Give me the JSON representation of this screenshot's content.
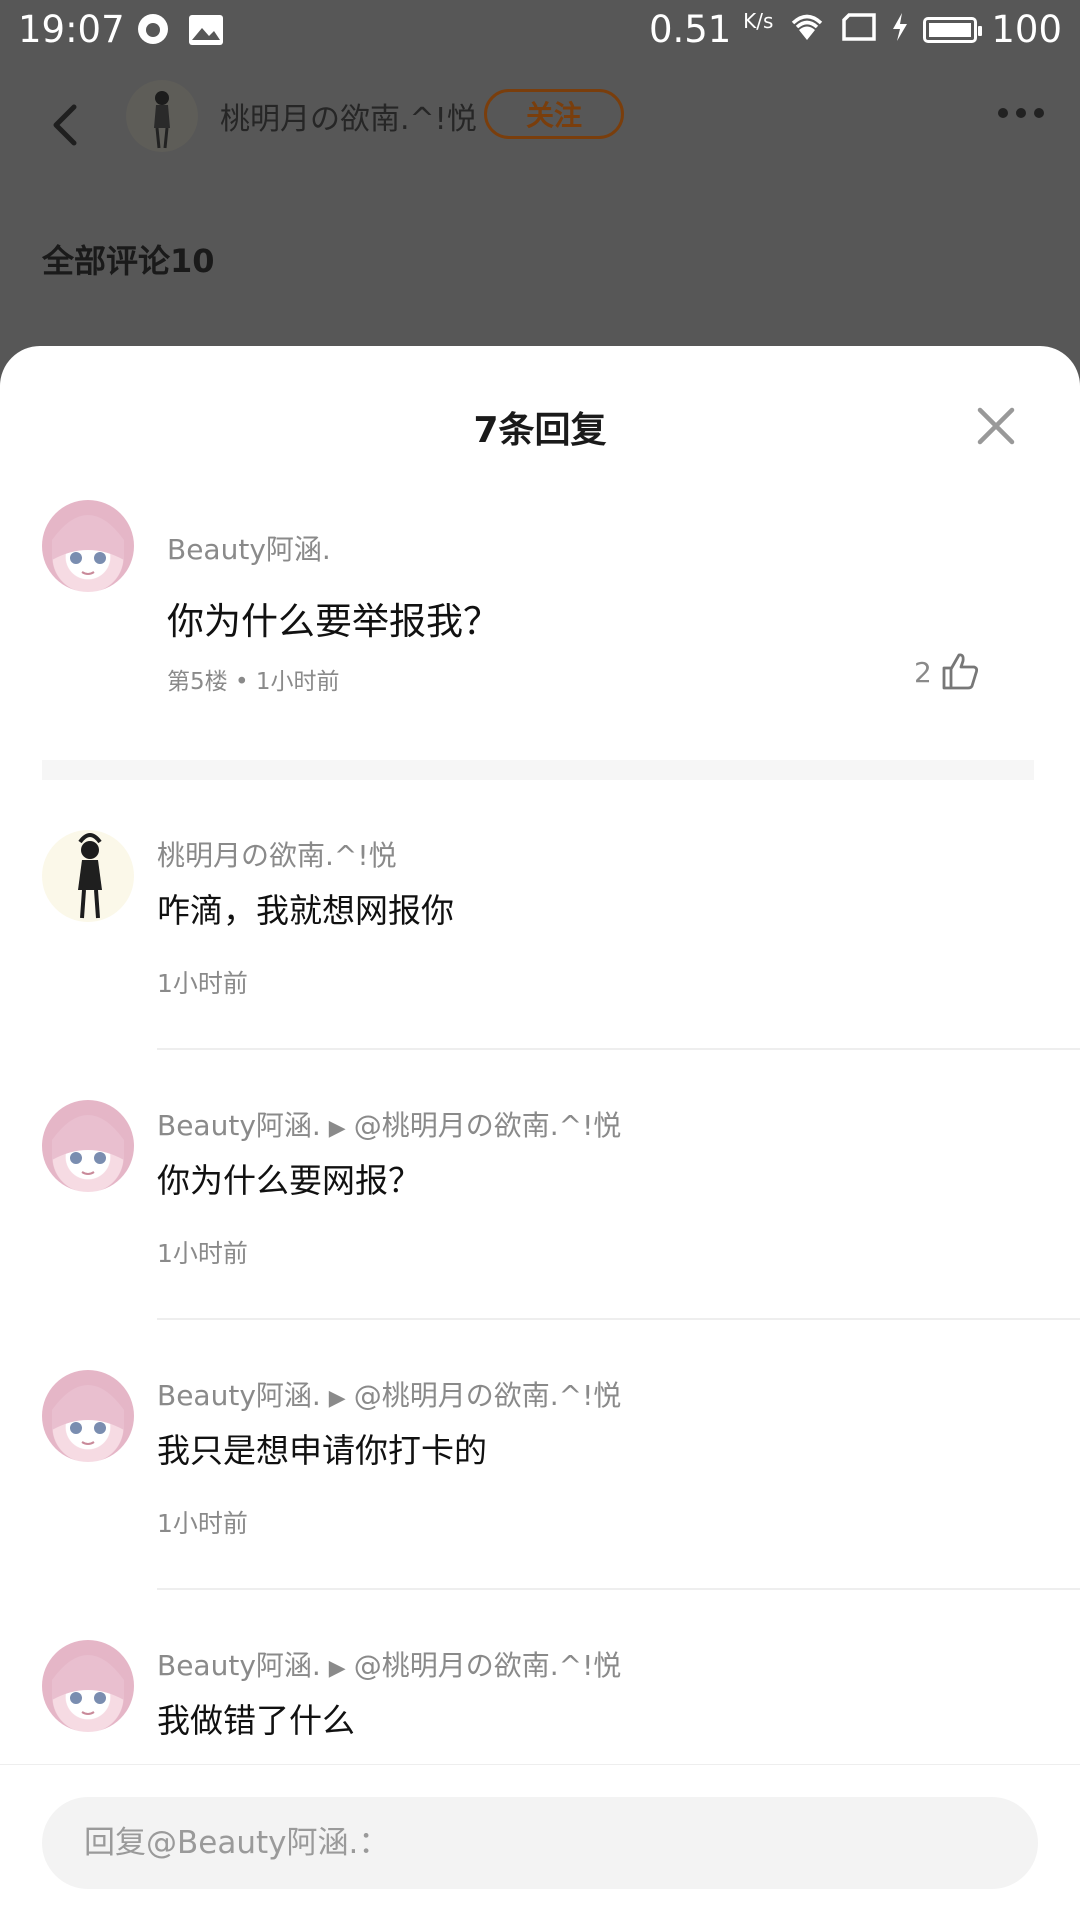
{
  "status_bar": {
    "time": "19:07",
    "speed": "0.51",
    "speed_unit": "K/s",
    "battery": "100"
  },
  "header": {
    "author_name": "桃明月の欲南.^!悦",
    "follow_label": "关注",
    "all_comments": "全部评论10"
  },
  "sheet": {
    "title": "7条回复",
    "main_comment": {
      "user": "Beauty阿涵.",
      "text": "你为什么要举报我？",
      "meta": "第5楼 • 1小时前",
      "likes": "2"
    },
    "replies": [
      {
        "user": "桃明月の欲南.^!悦",
        "target": "",
        "text": "咋滴，我就想网报你",
        "time": "1小时前",
        "avatar": "dark"
      },
      {
        "user": "Beauty阿涵.",
        "target": "@桃明月の欲南.^!悦",
        "text": "你为什么要网报？",
        "time": "1小时前",
        "avatar": "girl"
      },
      {
        "user": "Beauty阿涵.",
        "target": "@桃明月の欲南.^!悦",
        "text": "我只是想申请你打卡的",
        "time": "1小时前",
        "avatar": "girl"
      },
      {
        "user": "Beauty阿涵.",
        "target": "@桃明月の欲南.^!悦",
        "text": "我做错了什么",
        "time": "",
        "avatar": "girl"
      }
    ]
  },
  "reply_box": {
    "placeholder": "回复@Beauty阿涵.："
  },
  "colors": {
    "follow_accent": "#7a3e0c",
    "overlay": "#575757"
  }
}
